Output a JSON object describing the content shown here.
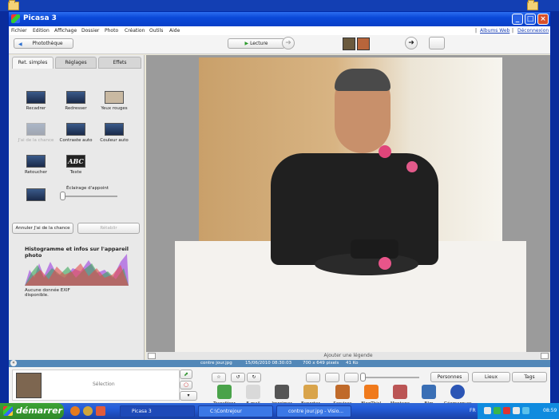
{
  "window": {
    "title": "Picasa 3"
  },
  "menu": {
    "items": [
      "Fichier",
      "Edition",
      "Affichage",
      "Dossier",
      "Photo",
      "Création",
      "Outils",
      "Aide"
    ],
    "links": [
      "Albums Web",
      "Déconnexion"
    ],
    "sep": "|"
  },
  "toolbar": {
    "library_label": "Photothèque",
    "play_label": "Lecture"
  },
  "tabs": [
    "Ret. simples",
    "Réglages",
    "Effets"
  ],
  "tools": [
    {
      "label": "Recadrer",
      "enabled": true
    },
    {
      "label": "Redresser",
      "enabled": true
    },
    {
      "label": "Yeux rouges",
      "enabled": true
    },
    {
      "label": "J'ai de la chance",
      "enabled": false
    },
    {
      "label": "Contraste auto",
      "enabled": true
    },
    {
      "label": "Couleur auto",
      "enabled": true
    },
    {
      "label": "Retoucher",
      "enabled": true
    },
    {
      "label": "Texte",
      "enabled": true
    },
    {
      "label": "Éclairage d'appoint",
      "enabled": true
    }
  ],
  "slider": {
    "label": "Éclairage d'appoint",
    "value": 0
  },
  "buttons": {
    "undo_label": "Annuler J'ai de la chance",
    "redo_label": "Rétablir"
  },
  "histogram": {
    "title": "Histogramme et infos sur l'appareil photo",
    "exif_text": "Aucune donnée EXIF disponible."
  },
  "caption": {
    "placeholder": "Ajouter une légende"
  },
  "info": {
    "filename": "contre jour.jpg",
    "datetime": "15/06/2010 08:30:03",
    "dims": "700 x 649 pixels",
    "size": "41 Ko"
  },
  "bottom": {
    "selection_label": "Sélection",
    "actions": [
      "Transférer",
      "E-mail",
      "Imprimer",
      "Exporter",
      "Services",
      "BlogThis!",
      "Montage",
      "Film",
      "Géomarquer"
    ],
    "tags": [
      "Personnes",
      "Lieux",
      "Tags"
    ],
    "colors": [
      "#4aa34a",
      "#d9d9d9",
      "#555",
      "#d9a44b",
      "#c06a2a",
      "#f07a1c",
      "#b55",
      "#3a6fb5",
      "#2b55b5"
    ]
  },
  "taskbar": {
    "start_label": "démarrer",
    "tasks": [
      "Picasa 3",
      "C:\\Contrejour",
      "contre jour.jpg - Visio..."
    ],
    "lang": "FR",
    "clock": "08:59"
  }
}
